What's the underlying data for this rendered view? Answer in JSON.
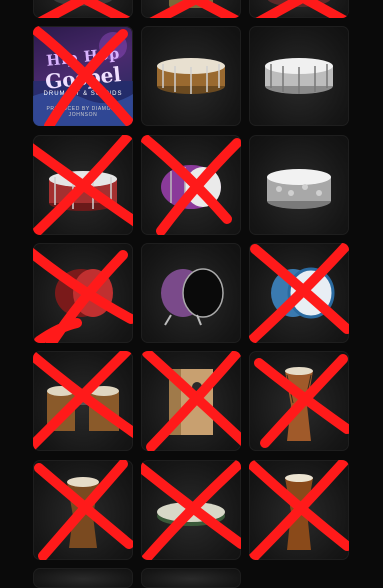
{
  "album": {
    "title_line1": "Hip Hop",
    "title_line2": "Gospel",
    "subtitle": "DRUM KIT & SOUNDS",
    "credit": "PRODUCED BY DIAMOND JOHNSON"
  },
  "colors": {
    "background": "#0a0a0a",
    "tile": "#1a1a1a",
    "x_mark": "#ff1a1a"
  },
  "tiles": [
    {
      "name": "tile-partial-top-left",
      "crossed": true
    },
    {
      "name": "tile-partial-top-center",
      "crossed": true
    },
    {
      "name": "tile-partial-top-right",
      "crossed": true
    },
    {
      "name": "tile-hiphop-gospel-album",
      "crossed": true
    },
    {
      "name": "tile-wood-snare",
      "crossed": false
    },
    {
      "name": "tile-chrome-snare",
      "crossed": false
    },
    {
      "name": "tile-red-snare",
      "crossed": true
    },
    {
      "name": "tile-purple-snare",
      "crossed": true
    },
    {
      "name": "tile-hammered-snare",
      "crossed": false
    },
    {
      "name": "tile-red-kick",
      "crossed": true
    },
    {
      "name": "tile-purple-kick",
      "crossed": false
    },
    {
      "name": "tile-blue-kick",
      "crossed": true
    },
    {
      "name": "tile-bongos",
      "crossed": true
    },
    {
      "name": "tile-cajon",
      "crossed": true
    },
    {
      "name": "tile-djembe-tall",
      "crossed": true
    },
    {
      "name": "tile-djembe-small",
      "crossed": true
    },
    {
      "name": "tile-frame-drum",
      "crossed": true
    },
    {
      "name": "tile-djembe-wood",
      "crossed": true
    }
  ]
}
